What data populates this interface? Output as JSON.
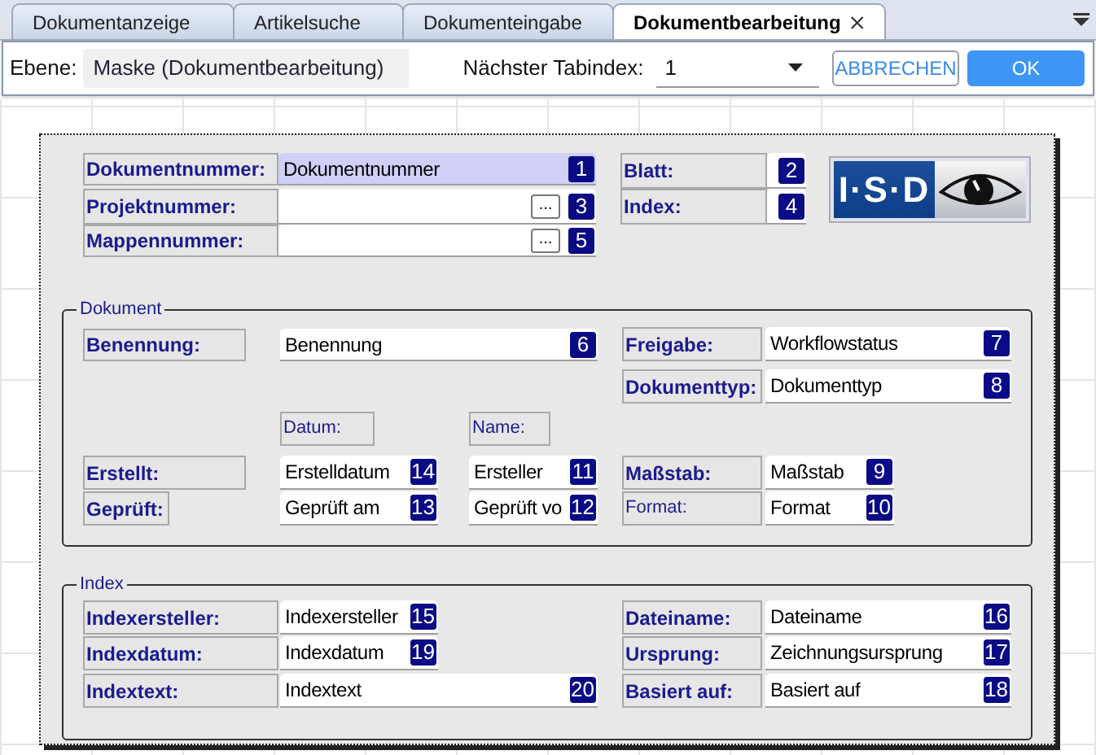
{
  "tabs": [
    {
      "label": "Dokumentanzeige",
      "selected": false
    },
    {
      "label": "Artikelsuche",
      "selected": false
    },
    {
      "label": "Dokumenteingabe",
      "selected": false
    },
    {
      "label": "Dokumentbearbeitung",
      "selected": true
    }
  ],
  "toolbar": {
    "ebene_label": "Ebene:",
    "ebene_value": "Maske (Dokumentbearbeitung)",
    "tabindex_label": "Nächster Tabindex:",
    "tabindex_value": "1",
    "buttons": [
      {
        "label": "ABBRECHEN",
        "kind": "secondary"
      },
      {
        "label": "OK",
        "kind": "primary"
      }
    ]
  },
  "canvas": {
    "header_fields": [
      {
        "label": "Dokumentnummer:",
        "value": "Dokumentnummer",
        "badge": "1",
        "browse": false,
        "highlighted": true
      },
      {
        "label": "Projektnummer:",
        "badge": "3",
        "browse": true,
        "browse_label": "...",
        "highlighted": false
      },
      {
        "label": "Mappennummer:",
        "badge": "5",
        "browse": true,
        "browse_label": "...",
        "highlighted": false
      },
      {
        "label": "Blatt:",
        "badge": "2",
        "browse": false,
        "highlighted": false
      },
      {
        "label": "Index:",
        "badge": "4",
        "browse": false,
        "highlighted": false
      }
    ],
    "logo": {
      "text": "I·S·D"
    },
    "dokument_group": {
      "title": "Dokument",
      "captions": [
        "Datum:",
        "Name:"
      ],
      "fields": [
        {
          "label": "Benennung:",
          "value": "Benennung",
          "badge": "6",
          "bold": true
        },
        {
          "label": "Freigabe:",
          "value": "Workflowstatus",
          "badge": "7",
          "bold": true
        },
        {
          "label": "Dokumenttyp:",
          "value": "Dokumenttyp",
          "badge": "8",
          "bold": true
        },
        {
          "label": "Erstellt:",
          "value": "Erstelldatum",
          "badge": "14",
          "bold": true
        },
        {
          "value": "Ersteller",
          "badge": "11"
        },
        {
          "label": "Maßstab:",
          "value": "Maßstab",
          "badge": "9",
          "bold": true
        },
        {
          "label": "Geprüft:",
          "value": "Geprüft am",
          "badge": "13",
          "bold": true
        },
        {
          "value": "Geprüft vo",
          "badge": "12"
        },
        {
          "label": "Format:",
          "value": "Format",
          "badge": "10",
          "bold": false
        }
      ]
    },
    "index_group": {
      "title": "Index",
      "fields": [
        {
          "label": "Indexersteller:",
          "value": "Indexersteller",
          "badge": "15"
        },
        {
          "label": "Indexdatum:",
          "value": "Indexdatum",
          "badge": "19"
        },
        {
          "label": "Indextext:",
          "value": "Indextext",
          "badge": "20"
        },
        {
          "label": "Dateiname:",
          "value": "Dateiname",
          "badge": "16"
        },
        {
          "label": "Ursprung:",
          "value": "Zeichnungsursprung",
          "badge": "17"
        },
        {
          "label": "Basiert auf:",
          "value": "Basiert auf",
          "badge": "18"
        }
      ]
    }
  }
}
